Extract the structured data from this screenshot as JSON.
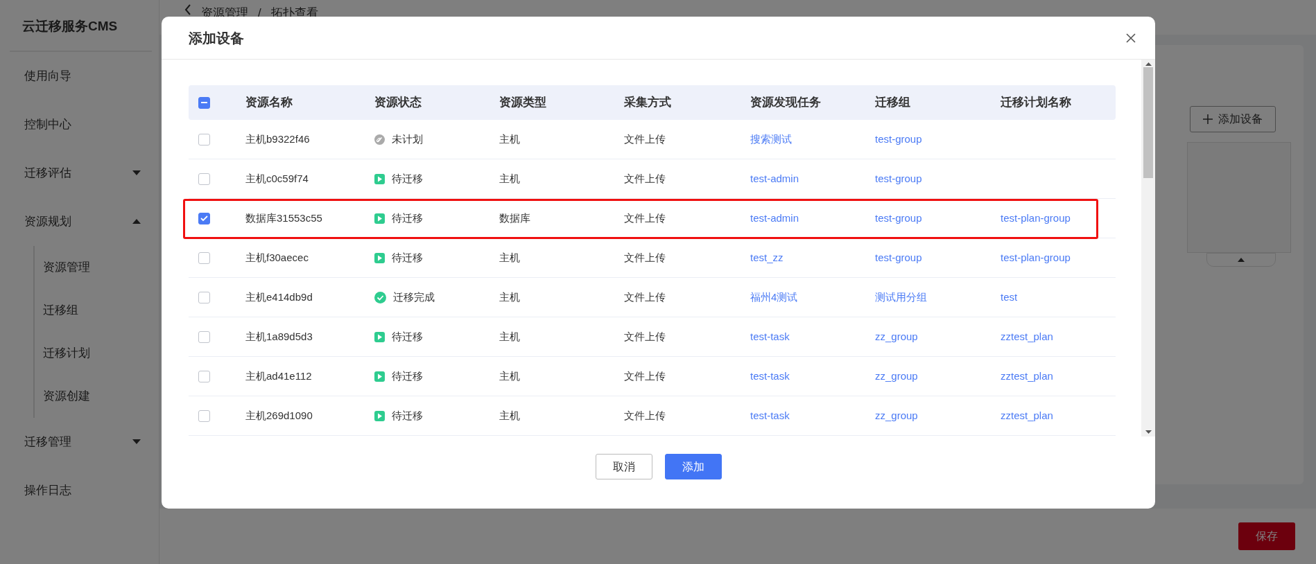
{
  "app_title": "云迁移服务CMS",
  "sidebar": {
    "items": [
      {
        "label": "使用向导"
      },
      {
        "label": "控制中心"
      },
      {
        "label": "迁移评估",
        "expanded": false
      },
      {
        "label": "资源规划",
        "expanded": true,
        "children": [
          {
            "label": "资源管理"
          },
          {
            "label": "迁移组"
          },
          {
            "label": "迁移计划"
          },
          {
            "label": "资源创建"
          }
        ]
      },
      {
        "label": "迁移管理",
        "expanded": false
      },
      {
        "label": "操作日志"
      }
    ]
  },
  "breadcrumb": [
    "资源管理",
    "/",
    "拓扑查看"
  ],
  "page": {
    "add_button": "添加设备",
    "save_button": "保存"
  },
  "dialog": {
    "title": "添加设备",
    "select_all": {
      "checked": true,
      "partial": true
    },
    "columns": [
      "资源名称",
      "资源状态",
      "资源类型",
      "采集方式",
      "资源发现任务",
      "迁移组",
      "迁移计划名称"
    ],
    "rows": [
      {
        "checked": false,
        "highlighted": false,
        "name": "主机b9322f46",
        "status": {
          "kind": "unplanned",
          "label": "未计划"
        },
        "type": "主机",
        "method": "文件上传",
        "task": "搜索测试",
        "group": "test-group"
      },
      {
        "checked": false,
        "highlighted": false,
        "name": "主机c0c59f74",
        "status": {
          "kind": "pending",
          "label": "待迁移"
        },
        "type": "主机",
        "method": "文件上传",
        "task": "test-admin",
        "group": "test-group"
      },
      {
        "checked": true,
        "highlighted": true,
        "name": "数据库31553c55",
        "status": {
          "kind": "pending",
          "label": "待迁移"
        },
        "type": "数据库",
        "method": "文件上传",
        "task": "test-admin",
        "group": "test-group",
        "plan": "test-plan-group"
      },
      {
        "checked": false,
        "highlighted": false,
        "name": "主机f30aecec",
        "status": {
          "kind": "pending",
          "label": "待迁移"
        },
        "type": "主机",
        "method": "文件上传",
        "task": "test_zz",
        "group": "test-group",
        "plan": "test-plan-group"
      },
      {
        "checked": false,
        "highlighted": false,
        "name": "主机e414db9d",
        "status": {
          "kind": "done",
          "label": "迁移完成"
        },
        "type": "主机",
        "method": "文件上传",
        "task": "福州4测试",
        "group": "测试用分组",
        "plan": "test"
      },
      {
        "checked": false,
        "highlighted": false,
        "name": "主机1a89d5d3",
        "status": {
          "kind": "pending",
          "label": "待迁移"
        },
        "type": "主机",
        "method": "文件上传",
        "task": "test-task",
        "group": "zz_group",
        "plan": "zztest_plan"
      },
      {
        "checked": false,
        "highlighted": false,
        "name": "主机ad41e112",
        "status": {
          "kind": "pending",
          "label": "待迁移"
        },
        "type": "主机",
        "method": "文件上传",
        "task": "test-task",
        "group": "zz_group",
        "plan": "zztest_plan"
      },
      {
        "checked": false,
        "highlighted": false,
        "name": "主机269d1090",
        "status": {
          "kind": "pending",
          "label": "待迁移"
        },
        "type": "主机",
        "method": "文件上传",
        "task": "test-task",
        "group": "zz_group",
        "plan": "zztest_plan"
      }
    ],
    "buttons": [
      {
        "kind": "secondary",
        "label": "取消"
      },
      {
        "kind": "primary",
        "label": "添加"
      }
    ]
  }
}
